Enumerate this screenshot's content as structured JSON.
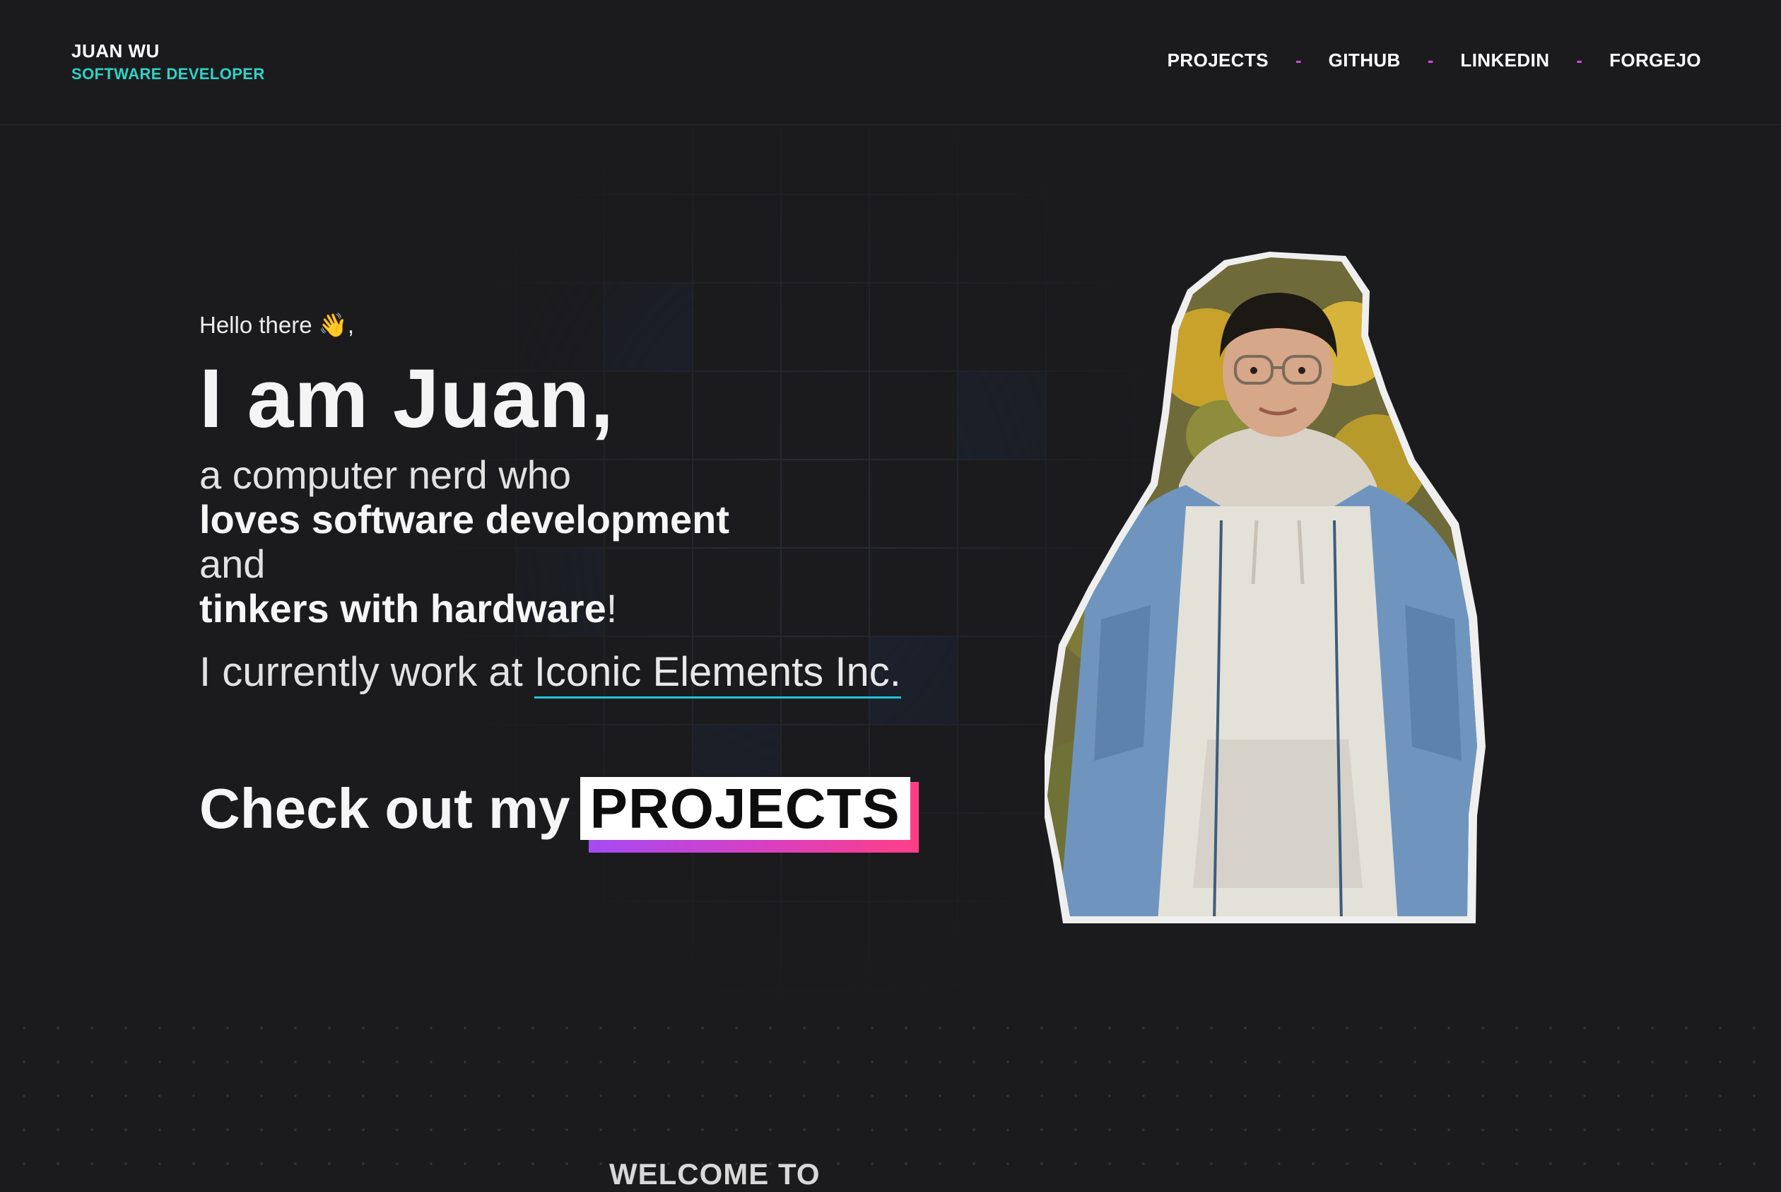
{
  "header": {
    "name": "JUAN WU",
    "role": "SOFTWARE DEVELOPER",
    "nav": [
      {
        "label": "PROJECTS"
      },
      {
        "label": "GITHUB"
      },
      {
        "label": "LINKEDIN"
      },
      {
        "label": "FORGEJO"
      }
    ],
    "separator": "-"
  },
  "hero": {
    "greeting": "Hello there 👋,",
    "headline": "I am Juan,",
    "line1": "a computer nerd who",
    "line2": "loves software development",
    "line3": "and",
    "line4_strong": "tinkers with hardware",
    "line4_end": "!",
    "work_prefix": "I currently work at ",
    "work_company": "Iconic Elements Inc.",
    "cta_text": "Check out my",
    "cta_button": "PROJECTS"
  },
  "portrait": {
    "icon": "person-photo"
  },
  "footer": {
    "welcome": "WELCOME TO"
  },
  "colors": {
    "background": "#1b1b1d",
    "accent_teal": "#2fd3c6",
    "separator_purple": "#c74ddc",
    "link_underline": "#22c3d6",
    "cta_gradient_start": "#a64bf4",
    "cta_gradient_end": "#ff3f86"
  }
}
